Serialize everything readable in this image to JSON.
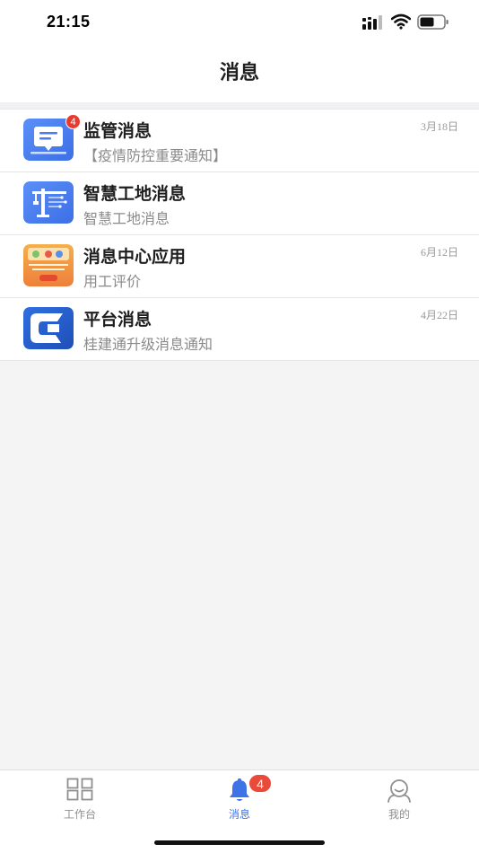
{
  "status_bar": {
    "time": "21:15"
  },
  "nav": {
    "title": "消息"
  },
  "messages": [
    {
      "title": "监管消息",
      "subtitle": "【疫情防控重要通知】",
      "date": "3月18日",
      "badge": "4",
      "icon": "monitor-chat-icon",
      "color": "#4a7cf0"
    },
    {
      "title": "智慧工地消息",
      "subtitle": "智慧工地消息",
      "date": "",
      "badge": "",
      "icon": "tower-crane-icon",
      "color": "#4a7cf0"
    },
    {
      "title": "消息中心应用",
      "subtitle": "用工评价",
      "date": "6月12日",
      "badge": "",
      "icon": "app-thumbnail-icon",
      "color": "#f0a040"
    },
    {
      "title": "平台消息",
      "subtitle": "桂建通升级消息通知",
      "date": "4月22日",
      "badge": "",
      "icon": "platform-logo-icon",
      "color": "#2f6fe0"
    }
  ],
  "tabs": [
    {
      "label": "工作台",
      "icon": "grid-icon",
      "active": false
    },
    {
      "label": "消息",
      "icon": "bell-icon",
      "active": true,
      "badge": "4"
    },
    {
      "label": "我的",
      "icon": "user-icon",
      "active": false
    }
  ],
  "colors": {
    "accent": "#3d73e6",
    "badge": "#e93a30"
  }
}
